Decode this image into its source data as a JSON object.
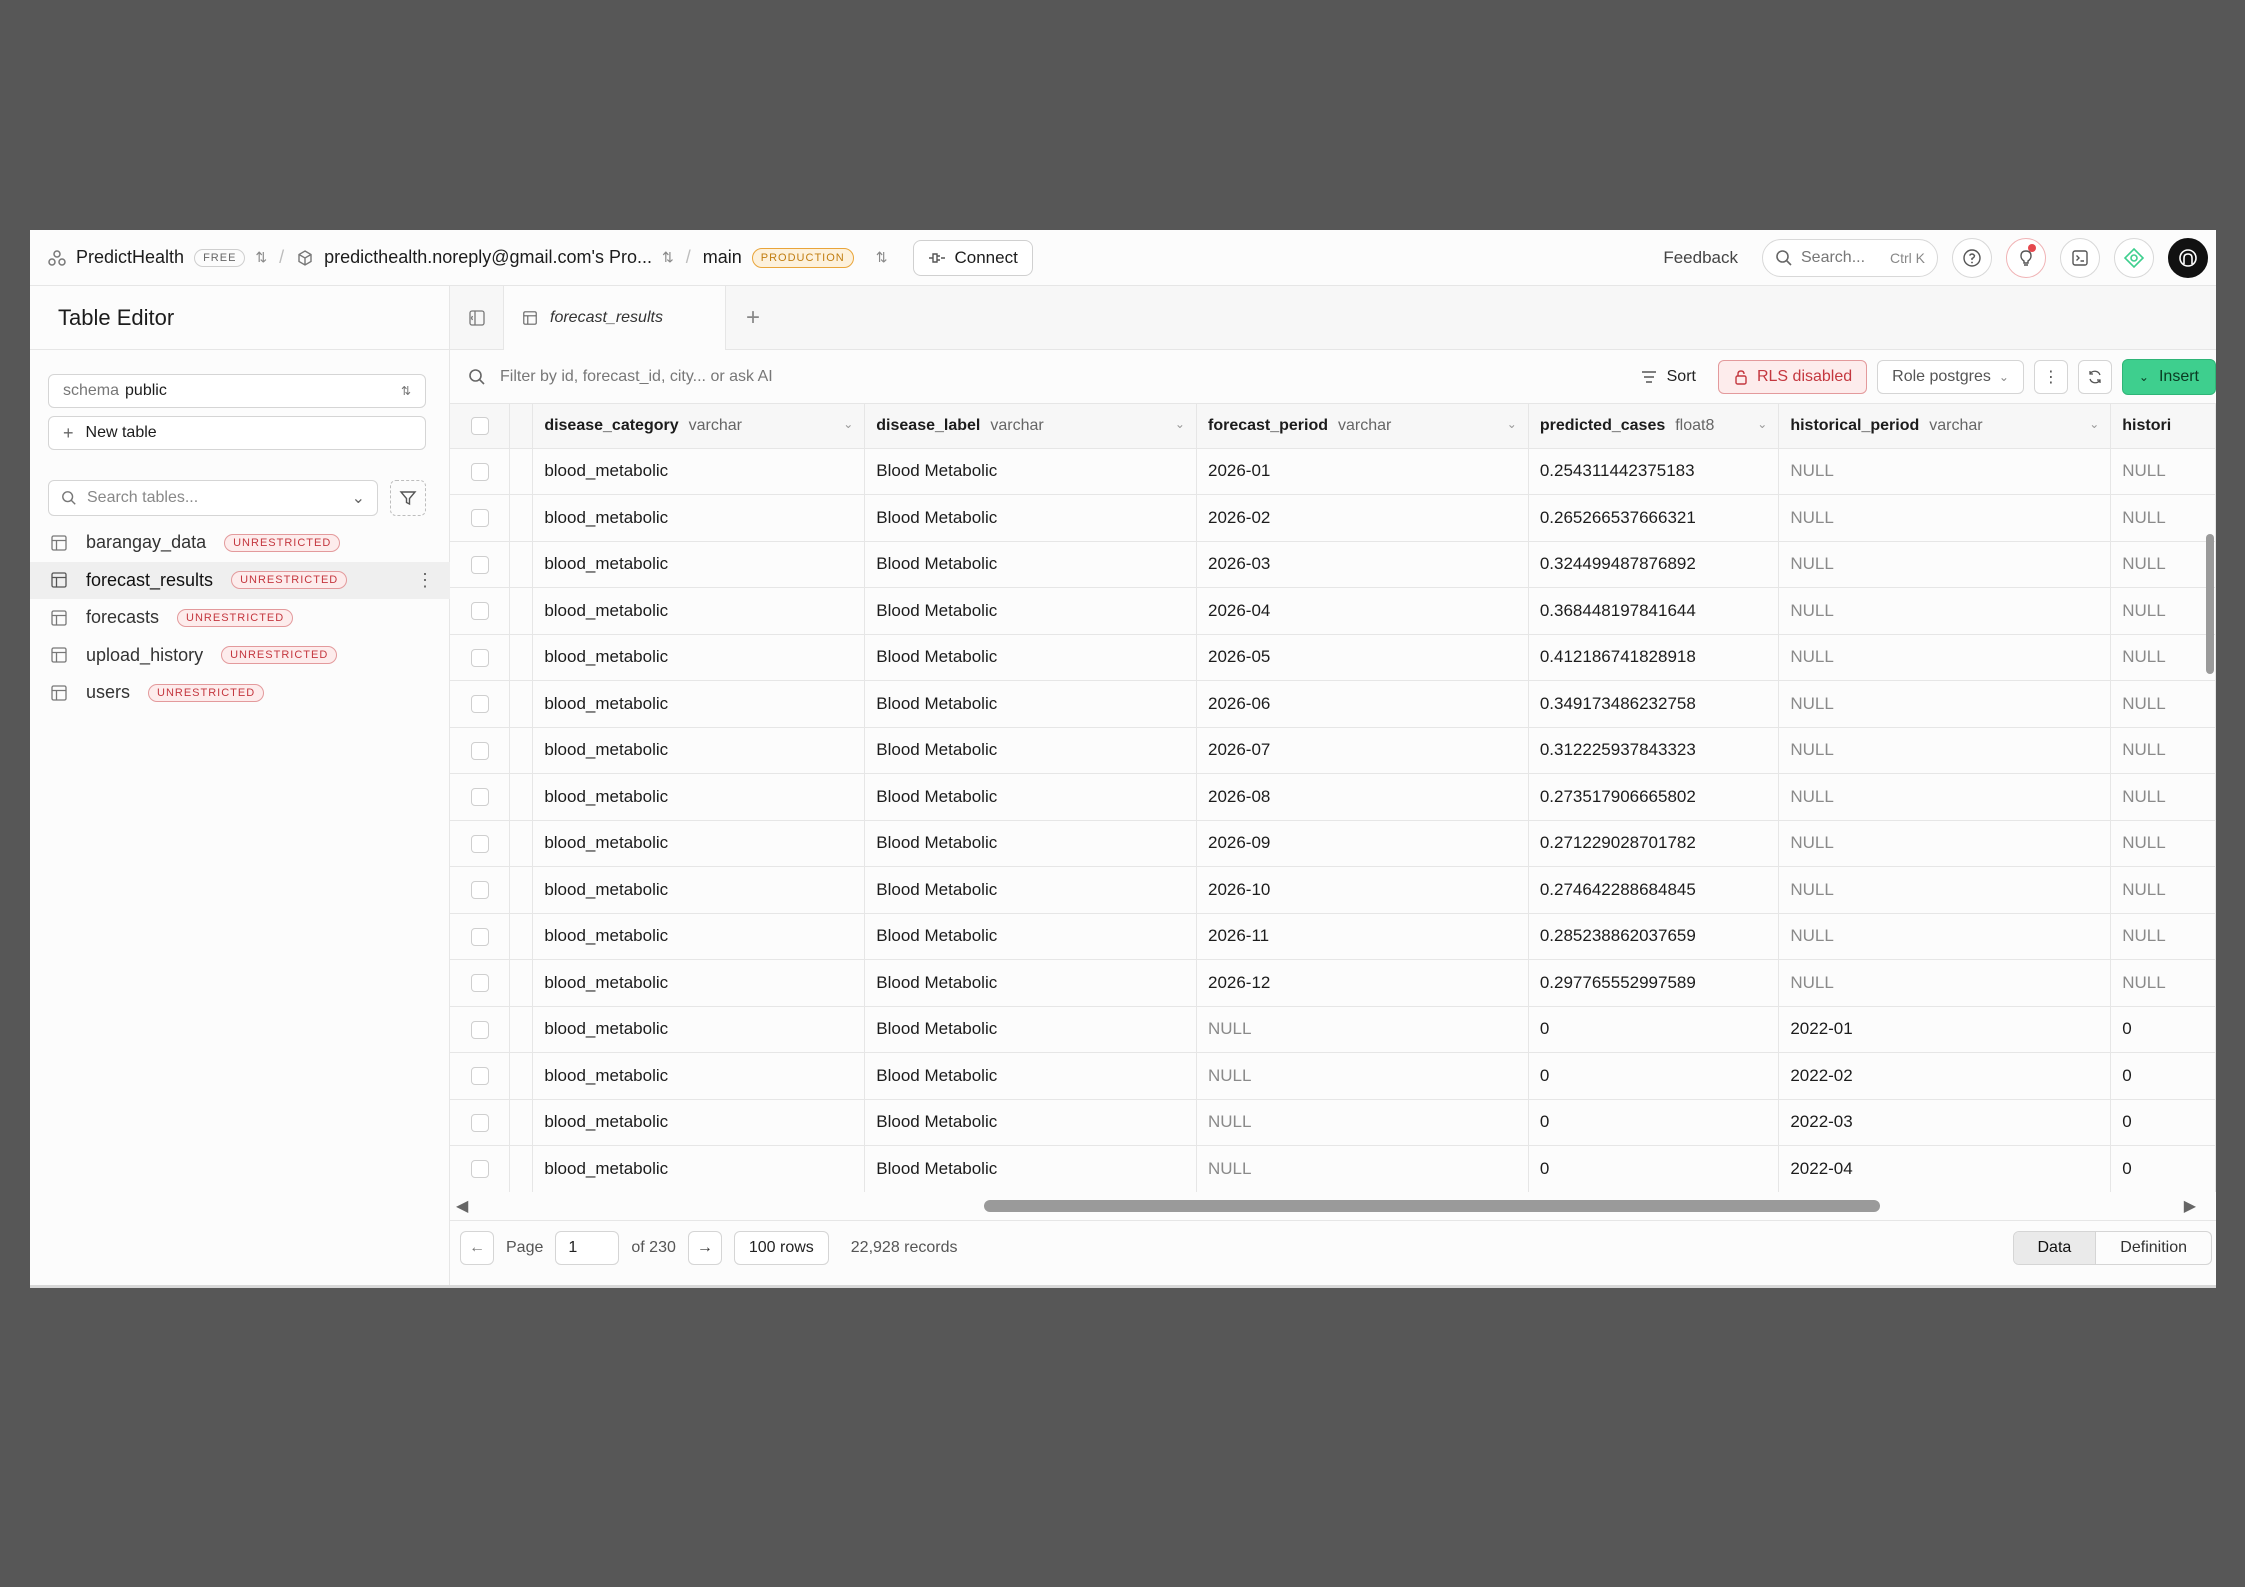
{
  "topbar": {
    "org_name": "PredictHealth",
    "org_plan": "FREE",
    "project_name": "predicthealth.noreply@gmail.com's Pro...",
    "branch": "main",
    "branch_badge": "PRODUCTION",
    "connect_label": "Connect",
    "feedback_label": "Feedback",
    "search_label": "Search...",
    "search_shortcut": "Ctrl K"
  },
  "sidebar": {
    "title": "Table Editor",
    "schema_label": "schema",
    "schema_value": "public",
    "new_table_label": "New table",
    "search_placeholder": "Search tables...",
    "tables": [
      {
        "name": "barangay_data",
        "badge": "UNRESTRICTED",
        "active": false
      },
      {
        "name": "forecast_results",
        "badge": "UNRESTRICTED",
        "active": true
      },
      {
        "name": "forecasts",
        "badge": "UNRESTRICTED",
        "active": false
      },
      {
        "name": "upload_history",
        "badge": "UNRESTRICTED",
        "active": false
      },
      {
        "name": "users",
        "badge": "UNRESTRICTED",
        "active": false
      }
    ]
  },
  "tabs": [
    {
      "label": "forecast_results"
    }
  ],
  "toolbar": {
    "filter_placeholder": "Filter by id, forecast_id, city... or ask AI",
    "sort_label": "Sort",
    "rls_label": "RLS disabled",
    "role_label": "Role postgres",
    "insert_label": "Insert"
  },
  "grid": {
    "columns": [
      {
        "name": "disease_category",
        "type": "varchar"
      },
      {
        "name": "disease_label",
        "type": "varchar"
      },
      {
        "name": "forecast_period",
        "type": "varchar"
      },
      {
        "name": "predicted_cases",
        "type": "float8"
      },
      {
        "name": "historical_period",
        "type": "varchar"
      },
      {
        "name": "histori",
        "type": ""
      }
    ],
    "rows": [
      [
        "blood_metabolic",
        "Blood Metabolic",
        "2026-01",
        "0.254311442375183",
        "NULL",
        "NULL"
      ],
      [
        "blood_metabolic",
        "Blood Metabolic",
        "2026-02",
        "0.265266537666321",
        "NULL",
        "NULL"
      ],
      [
        "blood_metabolic",
        "Blood Metabolic",
        "2026-03",
        "0.324499487876892",
        "NULL",
        "NULL"
      ],
      [
        "blood_metabolic",
        "Blood Metabolic",
        "2026-04",
        "0.368448197841644",
        "NULL",
        "NULL"
      ],
      [
        "blood_metabolic",
        "Blood Metabolic",
        "2026-05",
        "0.412186741828918",
        "NULL",
        "NULL"
      ],
      [
        "blood_metabolic",
        "Blood Metabolic",
        "2026-06",
        "0.349173486232758",
        "NULL",
        "NULL"
      ],
      [
        "blood_metabolic",
        "Blood Metabolic",
        "2026-07",
        "0.312225937843323",
        "NULL",
        "NULL"
      ],
      [
        "blood_metabolic",
        "Blood Metabolic",
        "2026-08",
        "0.273517906665802",
        "NULL",
        "NULL"
      ],
      [
        "blood_metabolic",
        "Blood Metabolic",
        "2026-09",
        "0.271229028701782",
        "NULL",
        "NULL"
      ],
      [
        "blood_metabolic",
        "Blood Metabolic",
        "2026-10",
        "0.274642288684845",
        "NULL",
        "NULL"
      ],
      [
        "blood_metabolic",
        "Blood Metabolic",
        "2026-11",
        "0.285238862037659",
        "NULL",
        "NULL"
      ],
      [
        "blood_metabolic",
        "Blood Metabolic",
        "2026-12",
        "0.297765552997589",
        "NULL",
        "NULL"
      ],
      [
        "blood_metabolic",
        "Blood Metabolic",
        "NULL",
        "0",
        "2022-01",
        "0"
      ],
      [
        "blood_metabolic",
        "Blood Metabolic",
        "NULL",
        "0",
        "2022-02",
        "0"
      ],
      [
        "blood_metabolic",
        "Blood Metabolic",
        "NULL",
        "0",
        "2022-03",
        "0"
      ],
      [
        "blood_metabolic",
        "Blood Metabolic",
        "NULL",
        "0",
        "2022-04",
        "0"
      ]
    ]
  },
  "footer": {
    "page_label": "Page",
    "page_value": "1",
    "of_pages": "of 230",
    "rows_label": "100 rows",
    "records_label": "22,928 records",
    "view_data": "Data",
    "view_definition": "Definition"
  },
  "colors": {
    "accent_green": "#3ecf8e",
    "unrestricted_red": "#c4373f",
    "production_orange": "#e9a53a"
  }
}
